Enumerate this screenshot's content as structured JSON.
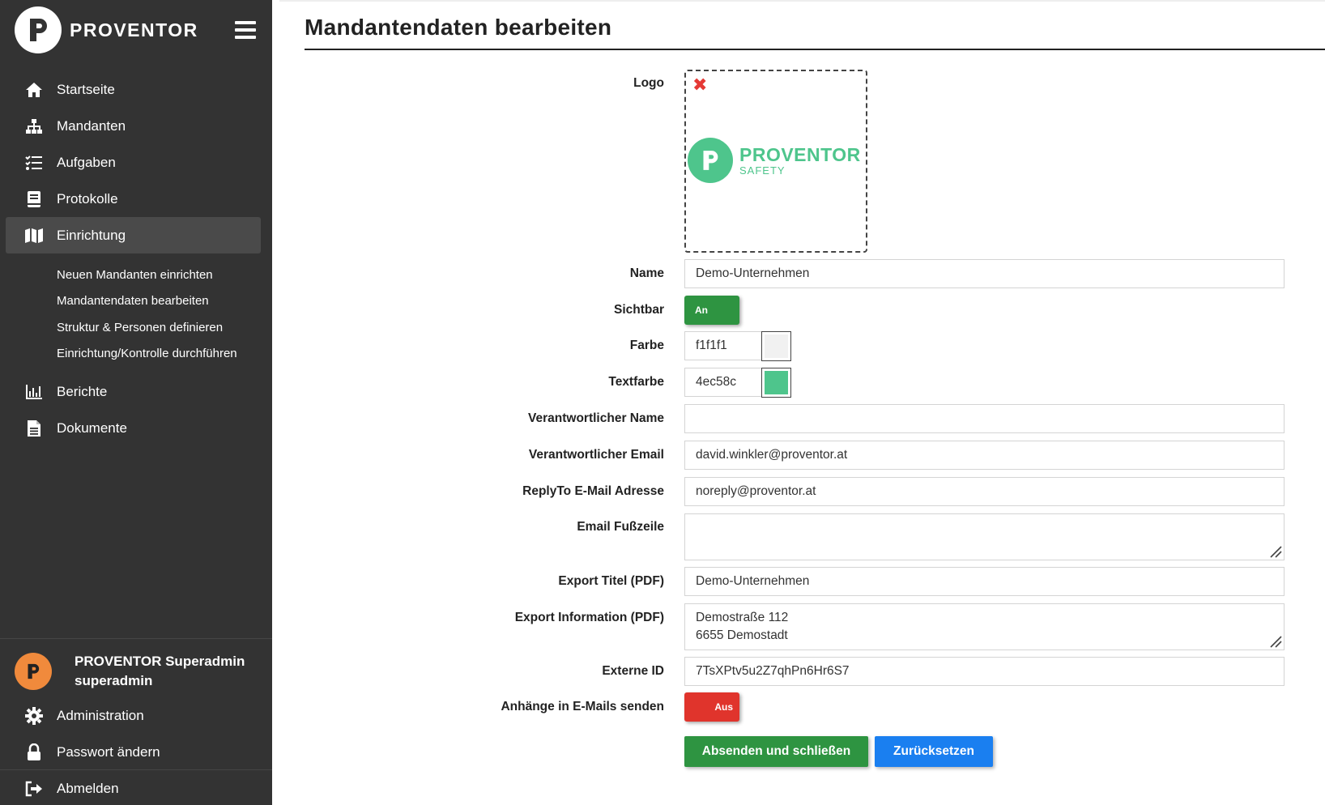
{
  "brand": {
    "name": "PROVENTOR",
    "logo_letter": "P"
  },
  "nav": {
    "items": [
      {
        "label": "Startseite",
        "icon": "home-icon"
      },
      {
        "label": "Mandanten",
        "icon": "sitemap-icon"
      },
      {
        "label": "Aufgaben",
        "icon": "tasks-icon"
      },
      {
        "label": "Protokolle",
        "icon": "book-icon"
      },
      {
        "label": "Einrichtung",
        "icon": "map-icon"
      }
    ],
    "subitems": [
      {
        "label": "Neuen Mandanten einrichten"
      },
      {
        "label": "Mandantendaten bearbeiten"
      },
      {
        "label": "Struktur & Personen definieren"
      },
      {
        "label": "Einrichtung/Kontrolle durchführen"
      }
    ],
    "items2": [
      {
        "label": "Berichte",
        "icon": "chart-icon"
      },
      {
        "label": "Dokumente",
        "icon": "document-icon"
      }
    ]
  },
  "user": {
    "name": "PROVENTOR Superadmin",
    "username": "superadmin",
    "avatar_letter": "P",
    "avatar_color": "#f08a3c"
  },
  "user_menu": {
    "administration": "Administration",
    "password": "Passwort ändern",
    "logout": "Abmelden"
  },
  "page": {
    "title": "Mandantendaten bearbeiten"
  },
  "form": {
    "logo_label": "Logo",
    "logo": {
      "word1": "PROVENTOR",
      "word2": "SAFETY",
      "letter": "P",
      "remove_symbol": "✖"
    },
    "name_label": "Name",
    "name_value": "Demo-Unternehmen",
    "visible_label": "Sichtbar",
    "visible_value": "An",
    "color_label": "Farbe",
    "color_value": "f1f1f1",
    "textcolor_label": "Textfarbe",
    "textcolor_value": "4ec58c",
    "resp_name_label": "Verantwortlicher Name",
    "resp_name_value": "",
    "resp_email_label": "Verantwortlicher Email",
    "resp_email_value": "david.winkler@proventor.at",
    "replyto_label": "ReplyTo E-Mail Adresse",
    "replyto_value": "noreply@proventor.at",
    "footer_label": "Email Fußzeile",
    "footer_value": "",
    "export_title_label": "Export Titel (PDF)",
    "export_title_value": "Demo-Unternehmen",
    "export_info_label": "Export Information (PDF)",
    "export_info_line1": "Demostraße 112",
    "export_info_line2": "6655 Demostadt",
    "external_id_label": "Externe ID",
    "external_id_value": "7TsXPtv5u2Z7qhPn6Hr6S7",
    "attachments_label": "Anhänge in E-Mails senden",
    "attachments_value": "Aus"
  },
  "buttons": {
    "submit": "Absenden und schließen",
    "reset": "Zurücksetzen"
  },
  "colors": {
    "sidebar": "#333333",
    "green": "#2e9441",
    "red": "#e0342c",
    "blue": "#1a7ff0",
    "accent": "#4ec58c",
    "swatch_color": "#f1f1f1",
    "swatch_textcolor": "#4ec58c"
  }
}
